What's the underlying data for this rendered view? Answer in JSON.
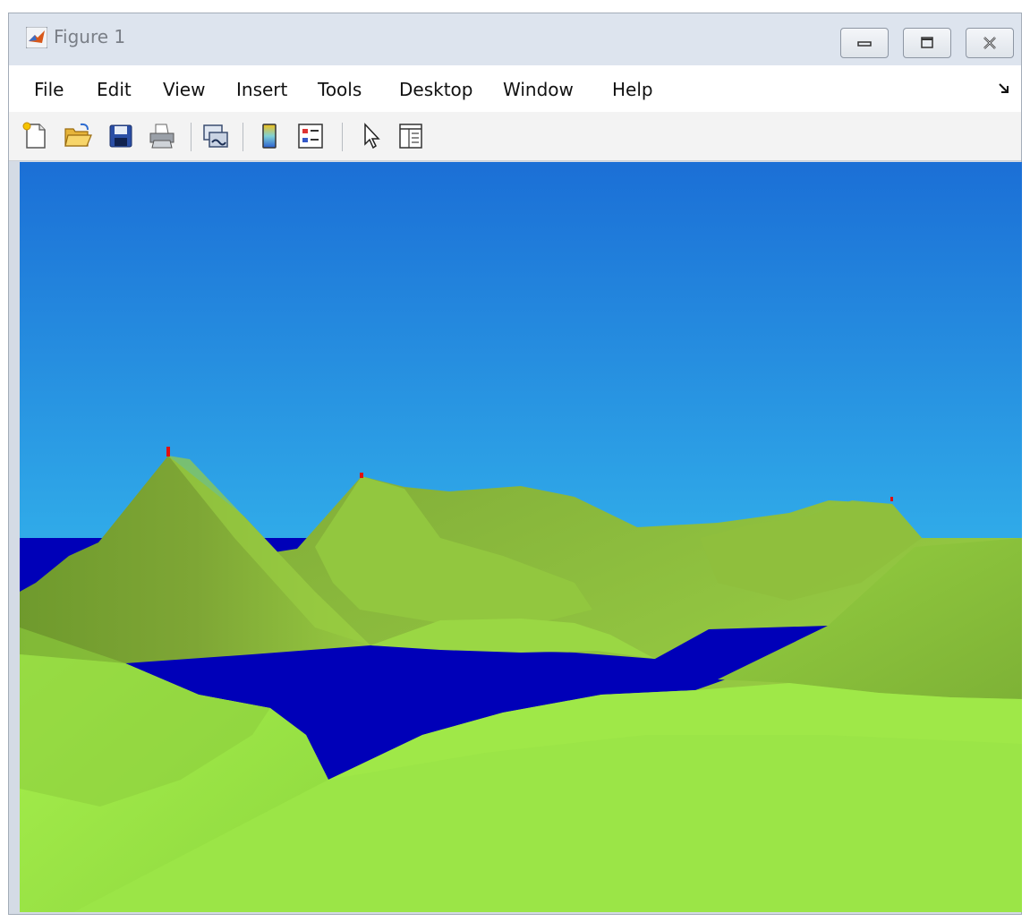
{
  "window": {
    "title": "Figure 1",
    "controls": [
      "minimize",
      "maximize",
      "close"
    ]
  },
  "menu": {
    "items": [
      "File",
      "Edit",
      "View",
      "Insert",
      "Tools",
      "Desktop",
      "Window",
      "Help"
    ]
  },
  "toolbar": {
    "buttons": [
      {
        "name": "new-figure",
        "icon": "new-file-icon"
      },
      {
        "name": "open-file",
        "icon": "open-folder-icon"
      },
      {
        "name": "save-figure",
        "icon": "save-disk-icon"
      },
      {
        "name": "print-figure",
        "icon": "printer-icon"
      },
      {
        "name": "link-plot",
        "icon": "link-plot-icon"
      },
      {
        "name": "insert-colorbar",
        "icon": "colorbar-icon"
      },
      {
        "name": "insert-legend",
        "icon": "legend-icon"
      },
      {
        "name": "edit-plot",
        "icon": "pointer-arrow-icon"
      },
      {
        "name": "property-inspector",
        "icon": "property-inspector-icon"
      }
    ]
  },
  "scene": {
    "sky_top": "#1b6fd6",
    "sky_bottom": "#45e6fb",
    "water": "#0000b8",
    "terrain_light": "#a8f24a",
    "terrain_mid": "#8ccd3e",
    "terrain_dark": "#6e9b2f",
    "peak_marker": "#e01010"
  }
}
